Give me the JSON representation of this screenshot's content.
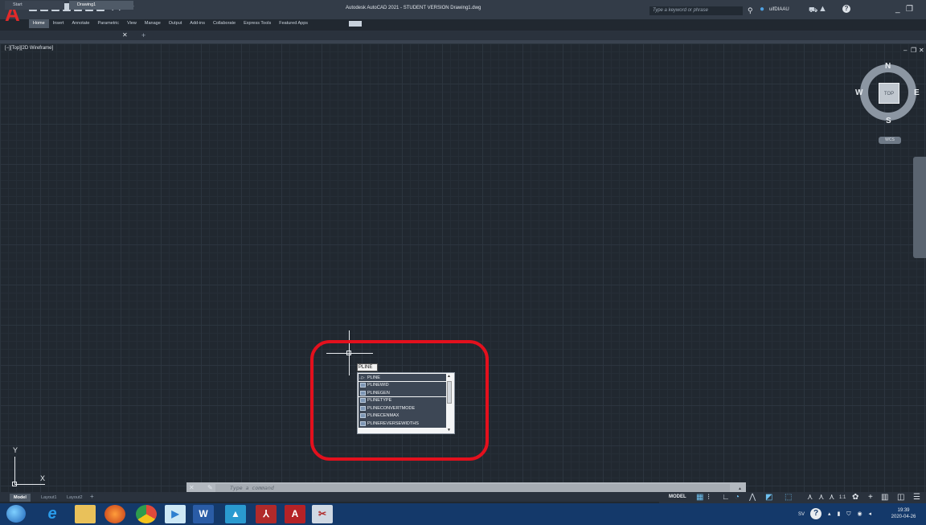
{
  "window": {
    "title": "Autodesk AutoCAD 2021 - STUDENT VERSION   Drawing1.dwg",
    "search_placeholder": "Type a keyword or phrase",
    "username": "uifDIAAU"
  },
  "ribbon": {
    "tabs": [
      "Home",
      "Insert",
      "Annotate",
      "Parametric",
      "View",
      "Manage",
      "Output",
      "Add-ins",
      "Collaborate",
      "Express Tools",
      "Featured Apps"
    ],
    "active_tab": "Home"
  },
  "document_tabs": [
    {
      "label": "Start"
    },
    {
      "label": "Drawing1"
    }
  ],
  "viewport": {
    "label": "[−][Top][2D Wireframe]"
  },
  "viewcube": {
    "top": "TOP",
    "north": "N",
    "south": "S",
    "west": "W",
    "east": "E",
    "wcs": "WCS"
  },
  "dynamic_input": {
    "value": "PLINE"
  },
  "autocomplete": {
    "items": [
      {
        "label": "PLINE",
        "icon": "command-arrow-icon"
      },
      {
        "label": "PLINEWID",
        "icon": "sysvar-icon"
      },
      {
        "label": "PLINEGEN",
        "icon": "sysvar-icon"
      },
      {
        "label": "PLINETYPE",
        "icon": "sysvar-icon"
      },
      {
        "label": "PLINECONVERTMODE",
        "icon": "sysvar-icon"
      },
      {
        "label": "PLINECENMAX",
        "icon": "sysvar-icon"
      },
      {
        "label": "PLINEREVERSEWIDTHS",
        "icon": "sysvar-icon"
      }
    ]
  },
  "ucs": {
    "x": "X",
    "y": "Y"
  },
  "command_line": {
    "placeholder": "Type a command"
  },
  "layout_tabs": [
    "Model",
    "Layout1",
    "Layout2"
  ],
  "status": {
    "model": "MODEL",
    "scale": "1:1"
  },
  "taskbar": {
    "language": "SV",
    "time": "19:39",
    "date": "2020-04-26"
  },
  "colors": {
    "canvas": "#212830",
    "highlight": "#e3101d",
    "taskbar": "#14396a"
  }
}
